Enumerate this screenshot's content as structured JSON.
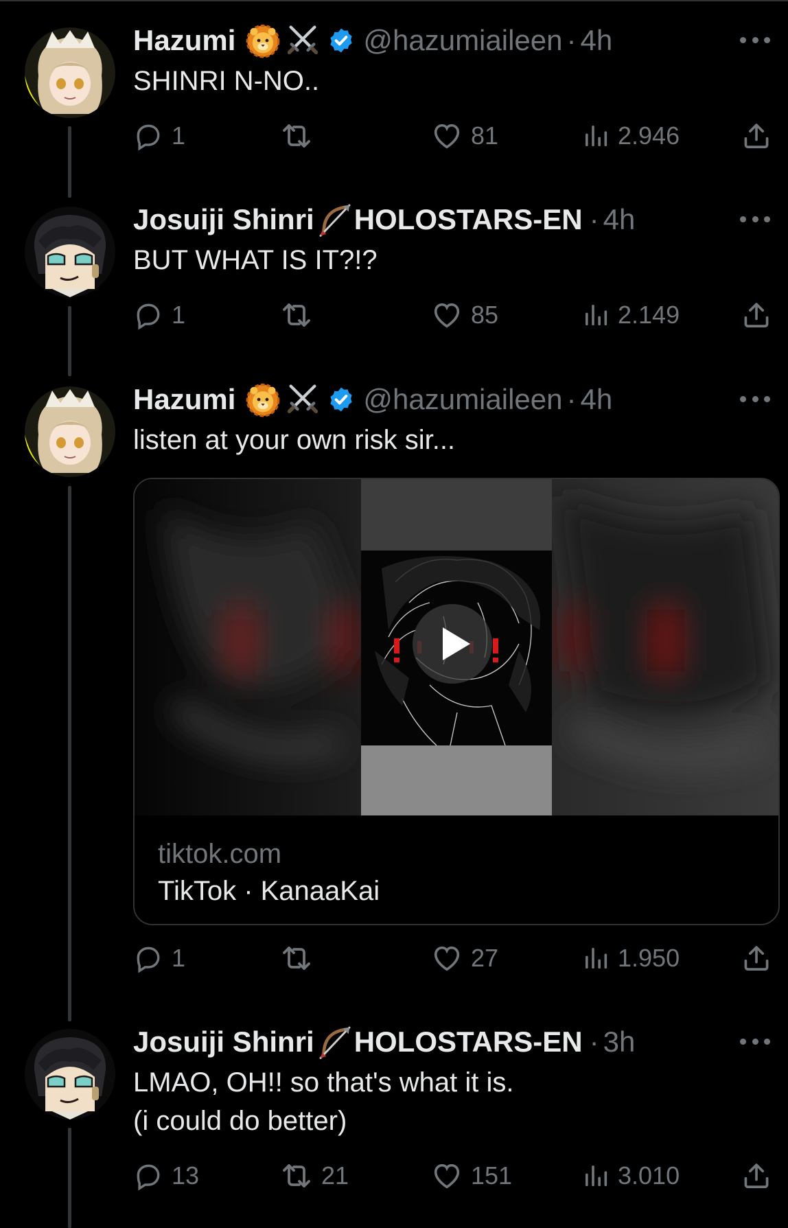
{
  "colors": {
    "background": "#000000",
    "text_primary": "#e7e9ea",
    "text_secondary": "#71767b",
    "verified_blue": "#1d9bf0",
    "divider": "#2f3336"
  },
  "icons": {
    "lion_emoji": "🦁",
    "swords_emoji": "⚔️",
    "bow_emoji": "🏹",
    "reply": "reply-icon",
    "retweet": "retweet-icon",
    "like": "heart-icon",
    "views": "views-icon",
    "share": "share-icon",
    "more": "more-icon",
    "verified": "verified-badge-icon",
    "play": "play-icon"
  },
  "tweets": [
    {
      "author_name": "Hazumi",
      "author_handle": "@hazumiaileen",
      "separator": "·",
      "time": "4h",
      "verified": true,
      "text": [
        "SHINRI N-NO.."
      ],
      "replies": "1",
      "retweets": "",
      "likes": "81",
      "views": "2.946"
    },
    {
      "author_name": "Josuiji Shinri",
      "author_name_suffix": "HOLOSTARS-EN",
      "author_handle": "",
      "separator": "·",
      "time": "4h",
      "verified": false,
      "text": [
        "BUT WHAT IS IT?!?"
      ],
      "replies": "1",
      "retweets": "",
      "likes": "85",
      "views": "2.149"
    },
    {
      "author_name": "Hazumi",
      "author_handle": "@hazumiaileen",
      "separator": "·",
      "time": "4h",
      "verified": true,
      "text": [
        "listen at your own risk sir..."
      ],
      "card": {
        "domain": "tiktok.com",
        "title": "TikTok · KanaaKai"
      },
      "replies": "1",
      "retweets": "",
      "likes": "27",
      "views": "1.950"
    },
    {
      "author_name": "Josuiji Shinri",
      "author_name_suffix": "HOLOSTARS-EN",
      "author_handle": "",
      "separator": "·",
      "time": "3h",
      "verified": false,
      "text": [
        "LMAO, OH!! so that's what it is.",
        "(i could do better)"
      ],
      "replies": "13",
      "retweets": "21",
      "likes": "151",
      "views": "3.010"
    }
  ]
}
